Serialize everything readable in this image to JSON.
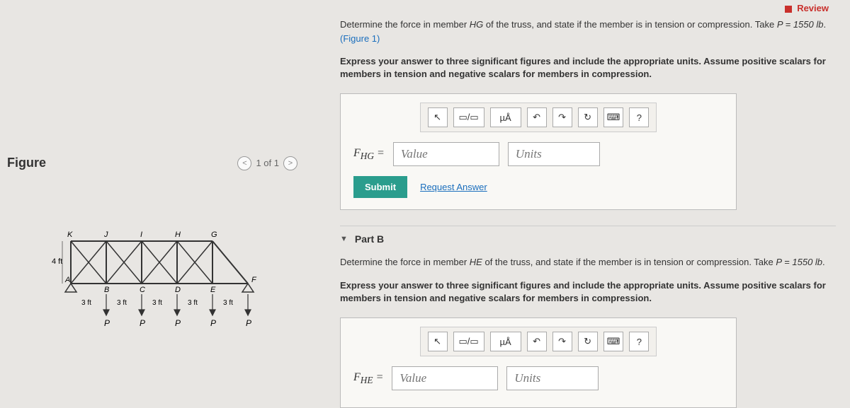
{
  "review_label": "Review",
  "figure": {
    "title": "Figure",
    "nav": "1 of 1",
    "nodes_top": [
      "K",
      "J",
      "I",
      "H",
      "G"
    ],
    "nodes_bot": [
      "A",
      "B",
      "C",
      "D",
      "E",
      "F"
    ],
    "height_label": "4 ft",
    "seg_labels": [
      "3 ft",
      "3 ft",
      "3 ft",
      "3 ft",
      "3 ft"
    ],
    "loads": [
      "P",
      "P",
      "P",
      "P",
      "P"
    ]
  },
  "partA": {
    "prompt_a": "Determine the force in member ",
    "member": "HG",
    "prompt_b": " of the truss, and state if the member is in tension or compression. Take ",
    "P_expr": "P = 1550 lb",
    "prompt_c": ".",
    "fig_ref": "(Figure 1)",
    "instr": "Express your answer to three significant figures and include the appropriate units. Assume positive scalars for members in tension and negative scalars for members in compression.",
    "var": "F_HG =",
    "value_ph": "Value",
    "units_ph": "Units",
    "submit": "Submit",
    "req": "Request Answer"
  },
  "partB": {
    "header": "Part B",
    "prompt_a": "Determine the force in member ",
    "member": "HE",
    "prompt_b": " of the truss, and state if the member is in tension or compression. Take ",
    "P_expr": "P = 1550 lb",
    "prompt_c": ".",
    "instr": "Express your answer to three significant figures and include the appropriate units. Assume positive scalars for members in tension and negative scalars for members in compression.",
    "var": "F_HE =",
    "value_ph": "Value",
    "units_ph": "Units"
  },
  "tools": {
    "cursor": "↖",
    "fraction": "▭/▭",
    "units_symbol": "µÅ",
    "undo": "↶",
    "redo": "↷",
    "reset": "↻",
    "keyboard": "⌨",
    "help": "?"
  }
}
